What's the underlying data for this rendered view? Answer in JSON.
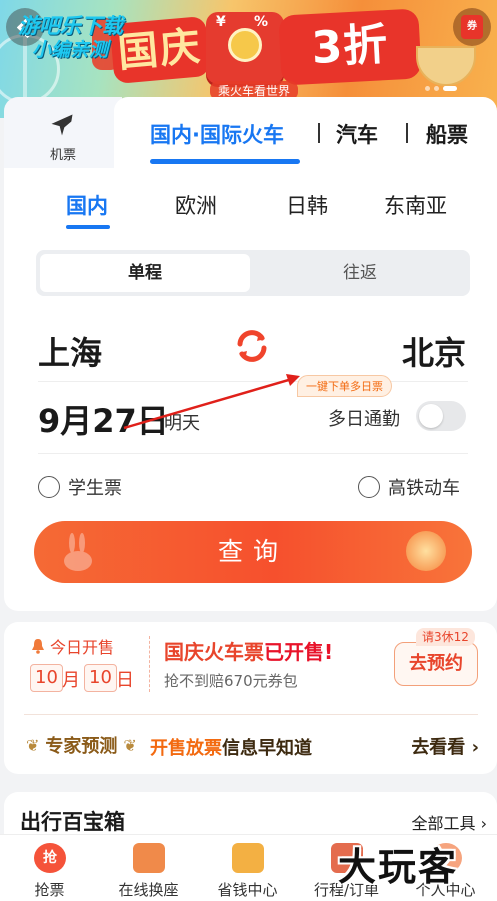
{
  "watermark": {
    "line1": "游吧乐下载",
    "line2": "小编亲测"
  },
  "banner": {
    "title_left": "国庆",
    "title_right": "3折GO",
    "subtitle": "乘火车看世界",
    "coupon_yen": "¥",
    "coupon_pct": "%",
    "gift_label": "券"
  },
  "transport_tabs": {
    "flight": "机票",
    "train": "国内·国际火车",
    "bus": "汽车",
    "ferry": "船票"
  },
  "regions": [
    "国内",
    "欧洲",
    "日韩",
    "东南亚"
  ],
  "trip_type": {
    "one_way": "单程",
    "round_trip": "往返"
  },
  "route": {
    "from": "上海",
    "to": "北京"
  },
  "multi_day_tip": "一键下单多日票",
  "date": {
    "value": "9月27日",
    "relative": "明天"
  },
  "commute_label": "多日通勤",
  "options": {
    "student": "学生票",
    "high_speed": "高铁动车"
  },
  "search_button": "查询",
  "sale": {
    "today_label": "今日开售",
    "date_month_num": "10",
    "date_month_char": "月",
    "date_day_num": "10",
    "date_day_char": "日",
    "headline_a": "国庆火车票",
    "headline_b": "已开售!",
    "sub": "抢不到赔670元券包",
    "reserve_tag": "请3休12",
    "reserve_button": "去预约",
    "expert": "专家预测",
    "info_a": "开售放票",
    "info_b": "信息早知道",
    "more": "去看看 ›"
  },
  "toolbox": {
    "title": "出行百宝箱",
    "all": "全部工具 ›"
  },
  "bottom_nav": [
    "抢票",
    "在线换座",
    "省钱中心",
    "行程/订单",
    "个人中心"
  ],
  "brand_watermark": "大玩客",
  "colors": {
    "accent": "#1877f2",
    "orange": "#f6502d",
    "sale_red": "#e8452c"
  }
}
